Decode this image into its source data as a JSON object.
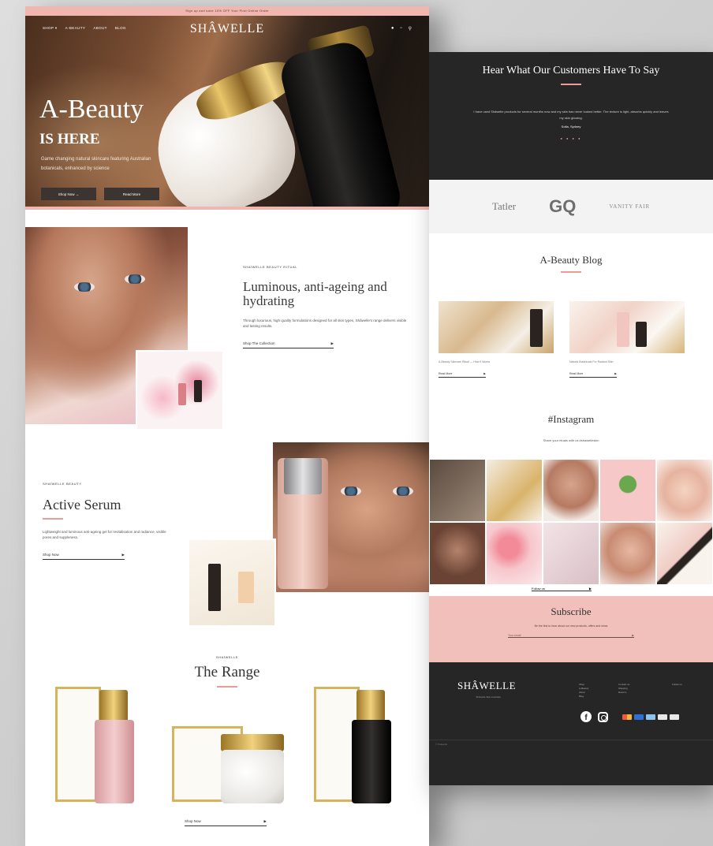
{
  "left_page": {
    "promo": "Sign up and save 10% OFF Your First Online Order",
    "nav": {
      "links": [
        "SHOP ▾",
        "A-BEAUTY",
        "ABOUT",
        "BLOG"
      ],
      "logo": "SHÂWELLE",
      "icons": [
        "user-icon",
        "bag-icon",
        "search-icon"
      ]
    },
    "hero": {
      "title": "A-Beauty",
      "subtitle": "IS HERE",
      "description": "Game changing natural skincare featuring Australian botanicals, enhanced by science",
      "button_primary": "Shop Now →",
      "button_secondary": "Read More"
    },
    "feature1": {
      "kicker": "SHAÏWELLE BEAUTY RITUAL",
      "title": "Luminous, anti-ageing and hydrating",
      "body": "Through luxurious, high quality formulations designed for all skin types, Shâwelle's range delivers visible and lasting results.",
      "link": "Shop The Collection"
    },
    "feature2": {
      "kicker": "SHAÏWELLE BEAUTY",
      "title": "Active Serum",
      "body": "Lightweight and luminous anti-ageing gel for revitalisation and radiance, visible pores and suppleness.",
      "link": "Shop Now"
    },
    "range": {
      "kicker": "SHAÏWELLE",
      "title": "The Range",
      "link": "Shop Now"
    }
  },
  "right_page": {
    "testimonial": {
      "title": "Hear What Our Customers Have To Say",
      "quote": "I have used Shâwelle products for several months now and my skin has never looked better. The texture is light, absorbs quickly and leaves my skin glowing.",
      "author": "Sofia, Sydney",
      "dots": "● ● ● ●"
    },
    "press": [
      "Tatler",
      "GQ",
      "VANITY FAIR"
    ],
    "blog": {
      "title": "A-Beauty Blog",
      "posts": [
        {
          "caption": "A-Beauty Skincare Ritual — How It Works",
          "link": "Read More"
        },
        {
          "caption": "Natural Botanicals For Radiant Skin",
          "link": "Read More"
        }
      ]
    },
    "instagram": {
      "title": "#Instagram",
      "subtitle": "Share your rituals with us #shawelleskin",
      "link": "Follow us"
    },
    "subscribe": {
      "title": "Subscribe",
      "text": "Be the first to hear about our new products, offers and news",
      "placeholder": "Your email"
    },
    "footer": {
      "logo": "SHÂWELLE",
      "address": "Shâwelle Skin\nAustralia",
      "col1": [
        "Shop",
        "A-Beauty",
        "About",
        "Blog"
      ],
      "col2": [
        "Contact us",
        "Shipping",
        "Returns"
      ],
      "col3": [
        "Follow us"
      ],
      "copyright": "© Shâwelle"
    }
  },
  "colors": {
    "accent_pink": "#f0b7b0",
    "dark": "#262626"
  }
}
